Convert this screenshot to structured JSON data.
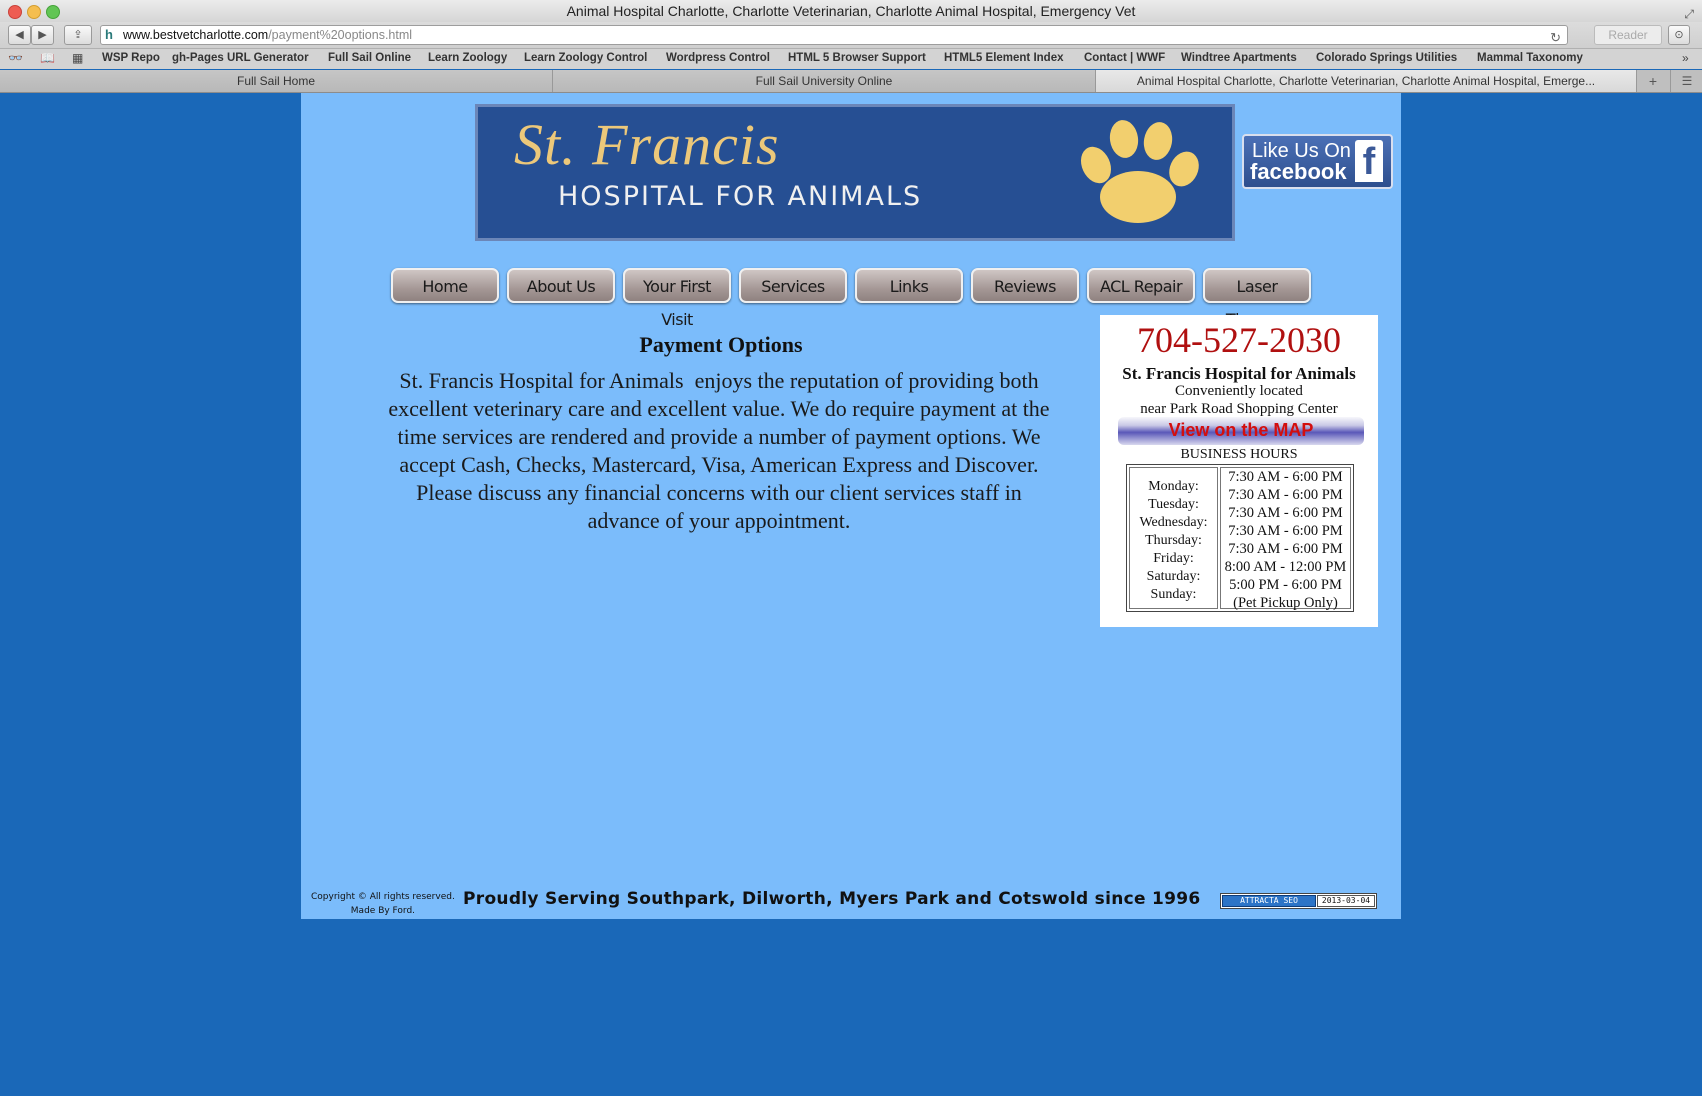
{
  "window": {
    "title": "Animal Hospital Charlotte, Charlotte Veterinarian, Charlotte Animal Hospital, Emergency Vet"
  },
  "toolbar": {
    "url_host": "www.bestvetcharlotte.com",
    "url_path": "/payment%20options.html",
    "reader_label": "Reader"
  },
  "bookmarks": [
    "WSP Repo",
    "gh-Pages URL Generator",
    "Full Sail Online",
    "Learn Zoology",
    "Learn Zoology Control",
    "Wordpress Control",
    "HTML 5 Browser Support",
    "HTML5 Element Index",
    "Contact | WWF",
    "Windtree Apartments",
    "Colorado Springs Utilities",
    "Mammal Taxonomy"
  ],
  "tabs": [
    {
      "label": "Full Sail Home"
    },
    {
      "label": "Full Sail University Online"
    },
    {
      "label": "Animal Hospital Charlotte, Charlotte Veterinarian, Charlotte Animal Hospital, Emerge..."
    }
  ],
  "banner": {
    "title": "St. Francis",
    "subtitle": "HOSPITAL FOR ANIMALS"
  },
  "facebook": {
    "like_text": "Like Us On",
    "brand": "facebook",
    "f": "f"
  },
  "nav": [
    "Home",
    "About Us",
    "Your First Visit",
    "Services",
    "Links",
    "Reviews",
    "ACL Repair",
    "Laser Therapy"
  ],
  "content": {
    "title": "Payment Options",
    "lines": [
      "St. Francis Hospital for Animals  enjoys the reputation of providing both",
      "excellent veterinary care and excellent value. We do require payment at the",
      "time services are rendered and provide a number of payment options. We",
      "accept Cash, Checks, Mastercard, Visa, American Express and Discover.",
      "Please discuss any financial concerns with our client services staff in",
      "advance of your appointment."
    ]
  },
  "info": {
    "phone": "704-527-2030",
    "name": "St. Francis Hospital for Animals",
    "conv1": "Conveniently located",
    "conv2": "near Park Road Shopping Center",
    "map_button": "View on the MAP",
    "hours_title": "BUSINESS HOURS",
    "days": [
      "Monday:",
      "Tuesday:",
      "Wednesday:",
      "Thursday:",
      "Friday:",
      "Saturday:",
      "Sunday:"
    ],
    "times": [
      "7:30 AM - 6:00 PM",
      "7:30 AM - 6:00 PM",
      "7:30 AM - 6:00 PM",
      "7:30 AM - 6:00 PM",
      "7:30 AM - 6:00 PM",
      "8:00 AM - 12:00 PM",
      "5:00 PM - 6:00 PM",
      "(Pet Pickup Only)"
    ]
  },
  "footer": {
    "copyright": "Copyright © All rights reserved.",
    "made_by": "Made By Ford.",
    "serving": "Proudly Serving Southpark, Dilworth, Myers Park and Cotswold since 1996",
    "seo_left": "ATTRACTA SEO",
    "seo_right": "2013-03-04"
  }
}
